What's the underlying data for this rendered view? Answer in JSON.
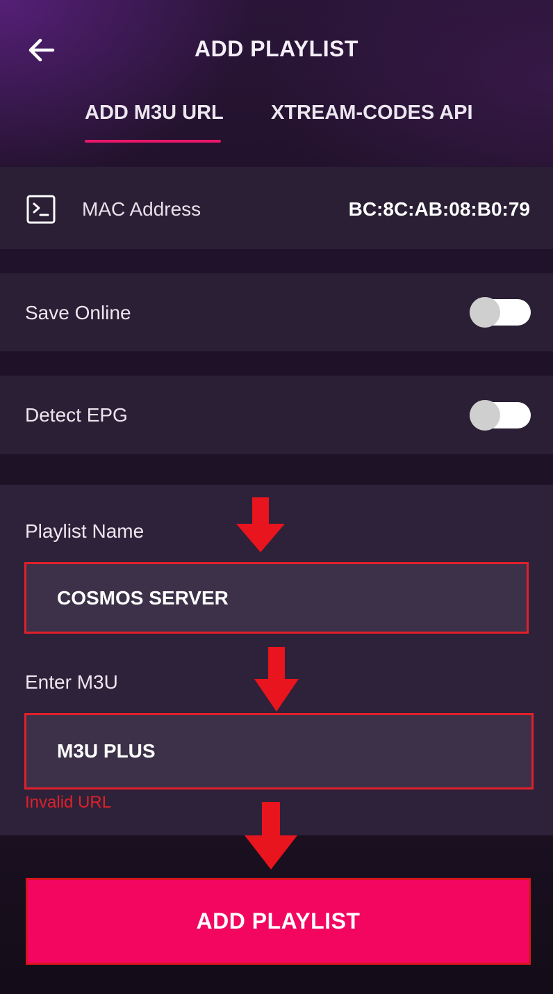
{
  "header": {
    "title": "ADD PLAYLIST",
    "back_icon": "arrow-left-icon"
  },
  "tabs": [
    {
      "label": "ADD M3U URL",
      "active": true
    },
    {
      "label": "XTREAM-CODES API",
      "active": false
    }
  ],
  "mac": {
    "icon": "terminal-icon",
    "label": "MAC Address",
    "value": "BC:8C:AB:08:B0:79"
  },
  "settings": {
    "save_online": {
      "label": "Save Online",
      "enabled": false
    },
    "detect_epg": {
      "label": "Detect EPG",
      "enabled": false
    }
  },
  "form": {
    "playlist_name": {
      "label": "Playlist Name",
      "value": "COSMOS SERVER"
    },
    "m3u": {
      "label": "Enter M3U",
      "value": "M3U PLUS",
      "error": "Invalid URL"
    }
  },
  "add_button": {
    "label": "ADD PLAYLIST"
  },
  "colors": {
    "accent": "#e8176a",
    "button": "#f30660",
    "annotation_red": "#e0202a",
    "card": "#2a1f35",
    "input": "#3d3149"
  }
}
